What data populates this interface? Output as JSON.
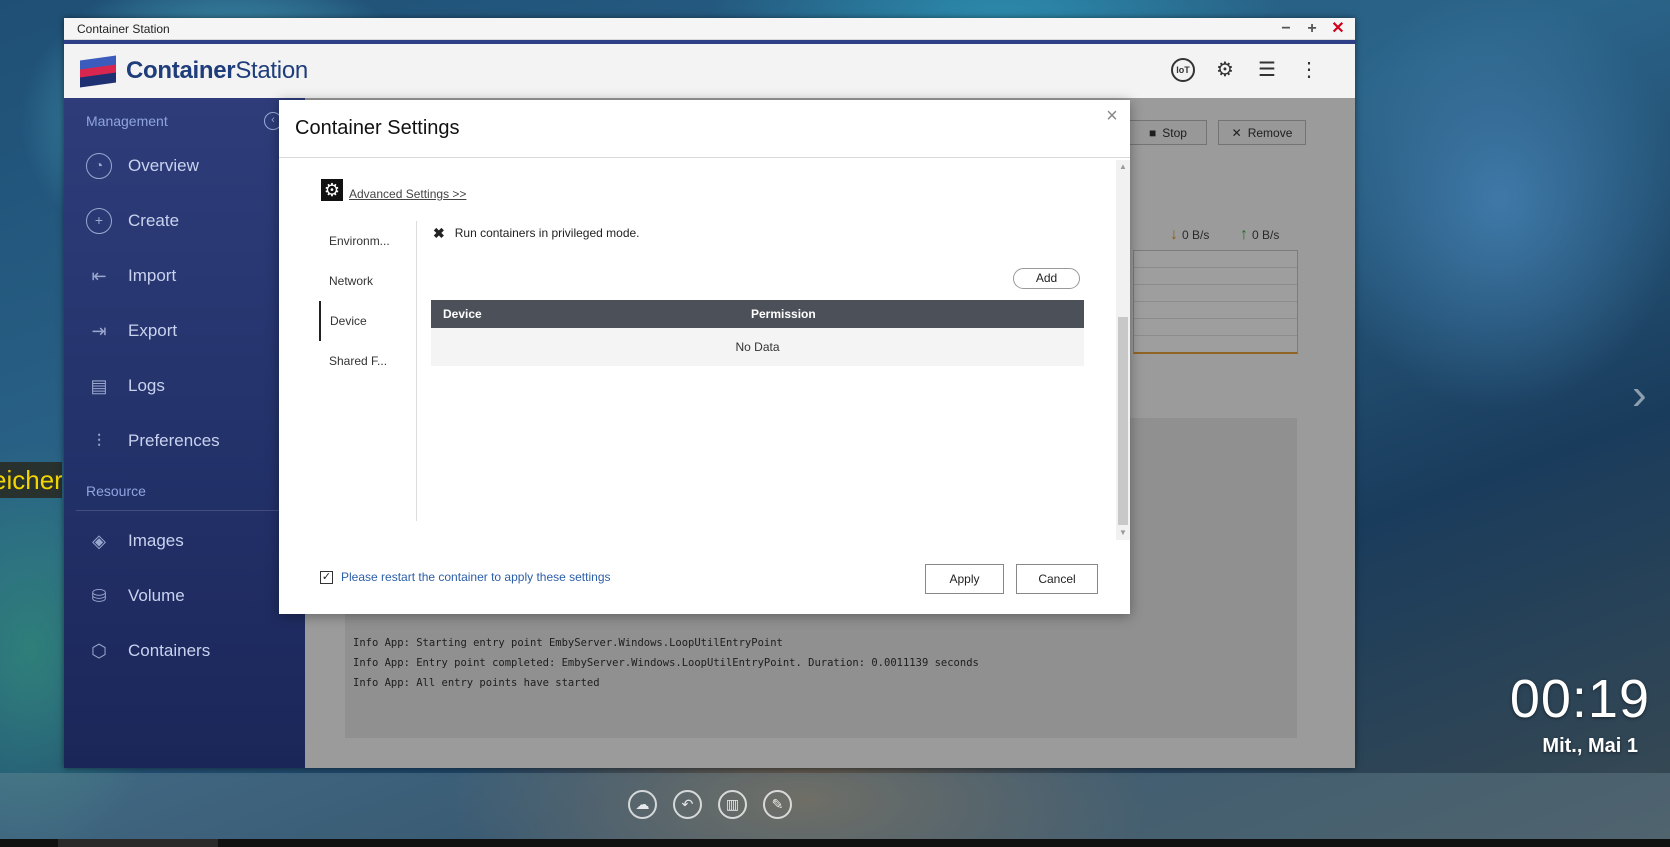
{
  "desktop": {
    "left_label": "eicher",
    "clock_time": "00:19",
    "clock_date": "Mit., Mai 1",
    "dock_icons": [
      "cloud-icon",
      "back-icon",
      "book-icon",
      "notes-icon"
    ]
  },
  "window": {
    "title": "Container Station",
    "controls": {
      "minimize": "−",
      "maximize": "+",
      "close": "✕"
    }
  },
  "app": {
    "brand_bold": "Container",
    "brand_regular": "Station",
    "header_icons": [
      "iot-icon",
      "gear-icon",
      "stack-icon",
      "more-icon"
    ],
    "iot_label": "IoT"
  },
  "sidebar": {
    "management_label": "Management",
    "resource_label": "Resource",
    "management_items": [
      {
        "label": "Overview",
        "icon": "gauge-icon"
      },
      {
        "label": "Create",
        "icon": "plus-icon"
      },
      {
        "label": "Import",
        "icon": "import-icon"
      },
      {
        "label": "Export",
        "icon": "export-icon"
      },
      {
        "label": "Logs",
        "icon": "document-icon"
      },
      {
        "label": "Preferences",
        "icon": "sliders-icon"
      }
    ],
    "resource_items": [
      {
        "label": "Images",
        "icon": "layers-icon"
      },
      {
        "label": "Volume",
        "icon": "cylinder-icon"
      },
      {
        "label": "Containers",
        "icon": "cube-icon"
      }
    ]
  },
  "main": {
    "stop_label": "Stop",
    "remove_label": "Remove",
    "download_speed": "0 B/s",
    "upload_speed": "0 B/s",
    "log_lines": [
      "Info App: Starting entry point EmbyServer.Windows.LoopUtilEntryPoint",
      "Info App: Entry point completed: EmbyServer.Windows.LoopUtilEntryPoint. Duration: 0.0011139 seconds",
      "Info App: All entry points have started"
    ]
  },
  "modal": {
    "title": "Container Settings",
    "advanced_link": "Advanced Settings >>",
    "tabs": [
      "Environm...",
      "Network",
      "Device",
      "Shared F..."
    ],
    "active_tab": "Device",
    "privileged_text": "Run containers in privileged mode.",
    "add_label": "Add",
    "table": {
      "headers": [
        "Device",
        "Permission"
      ],
      "empty_text": "No Data"
    },
    "restart_text": "Please restart the container to apply these settings",
    "restart_checked": true,
    "apply_label": "Apply",
    "cancel_label": "Cancel"
  }
}
